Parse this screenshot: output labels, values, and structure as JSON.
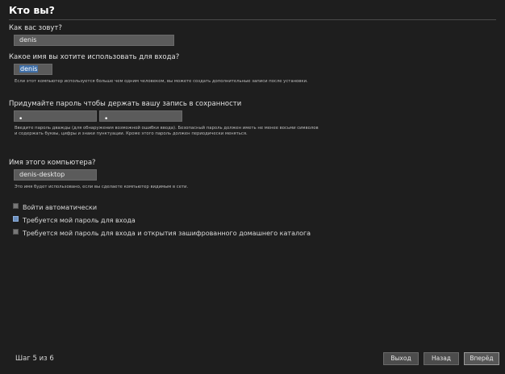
{
  "header": {
    "title": "Кто вы?"
  },
  "name": {
    "label": "Как вас зовут?",
    "value": "denis"
  },
  "login": {
    "label": "Какое имя вы хотите использовать для входа?",
    "value": "denis",
    "hint": "Если этот компьютер используется больше чем одним человеком, вы можете создать дополнительные записи после установки."
  },
  "password": {
    "label": "Придумайте пароль чтобы держать вашу запись в сохранности",
    "value": "•",
    "confirm_value": "•",
    "hint": "Введите пароль дважды (для обнаружения возможной ошибки ввода). Безопасный пароль должен иметь не менее восьми символов и содержать буквы, цифры и знаки пунктуации. Кроме этого пароль должен периодически меняться."
  },
  "computer": {
    "label": "Имя этого компьютера?",
    "value": "denis-desktop",
    "hint": "Это имя будет использовано, если вы сделаете компьютер видимым в сети."
  },
  "options": [
    {
      "label": "Войти автоматически",
      "checked": false
    },
    {
      "label": "Требуется мой пароль для входа",
      "checked": true
    },
    {
      "label": "Требуется мой пароль для входа и открытия зашифрованного домашнего каталога",
      "checked": false
    }
  ],
  "footer": {
    "step": "Шаг 5 из 6",
    "quit": "Выход",
    "back": "Назад",
    "forward": "Вперёд"
  }
}
